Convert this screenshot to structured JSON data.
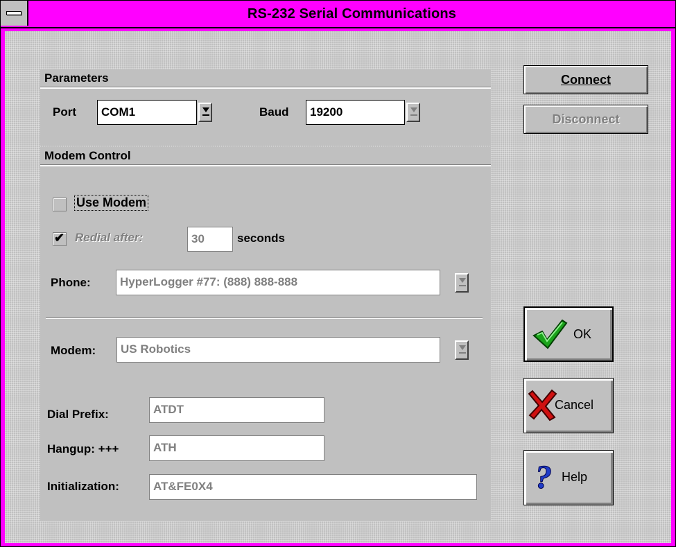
{
  "window": {
    "title": "RS-232 Serial Communications"
  },
  "parameters": {
    "header": "Parameters",
    "port_label": "Port",
    "port_value": "COM1",
    "baud_label": "Baud",
    "baud_value": "19200"
  },
  "modem_control": {
    "header": "Modem Control",
    "use_modem_label": "Use Modem",
    "use_modem_checked": false,
    "redial_label": "Redial after:",
    "redial_checked": true,
    "redial_seconds": "30",
    "seconds_label": "seconds",
    "phone_label": "Phone:",
    "phone_value": "HyperLogger #77:  (888) 888-888",
    "modem_label": "Modem:",
    "modem_value": "US Robotics",
    "dial_prefix_label": "Dial Prefix:",
    "dial_prefix_value": "ATDT",
    "hangup_label": "Hangup: +++",
    "hangup_value": "ATH",
    "init_label": "Initialization:",
    "init_value": "AT&FE0X4"
  },
  "buttons": {
    "connect": "Connect",
    "disconnect": "Disconnect",
    "ok": "OK",
    "cancel": "Cancel",
    "help": "Help"
  }
}
